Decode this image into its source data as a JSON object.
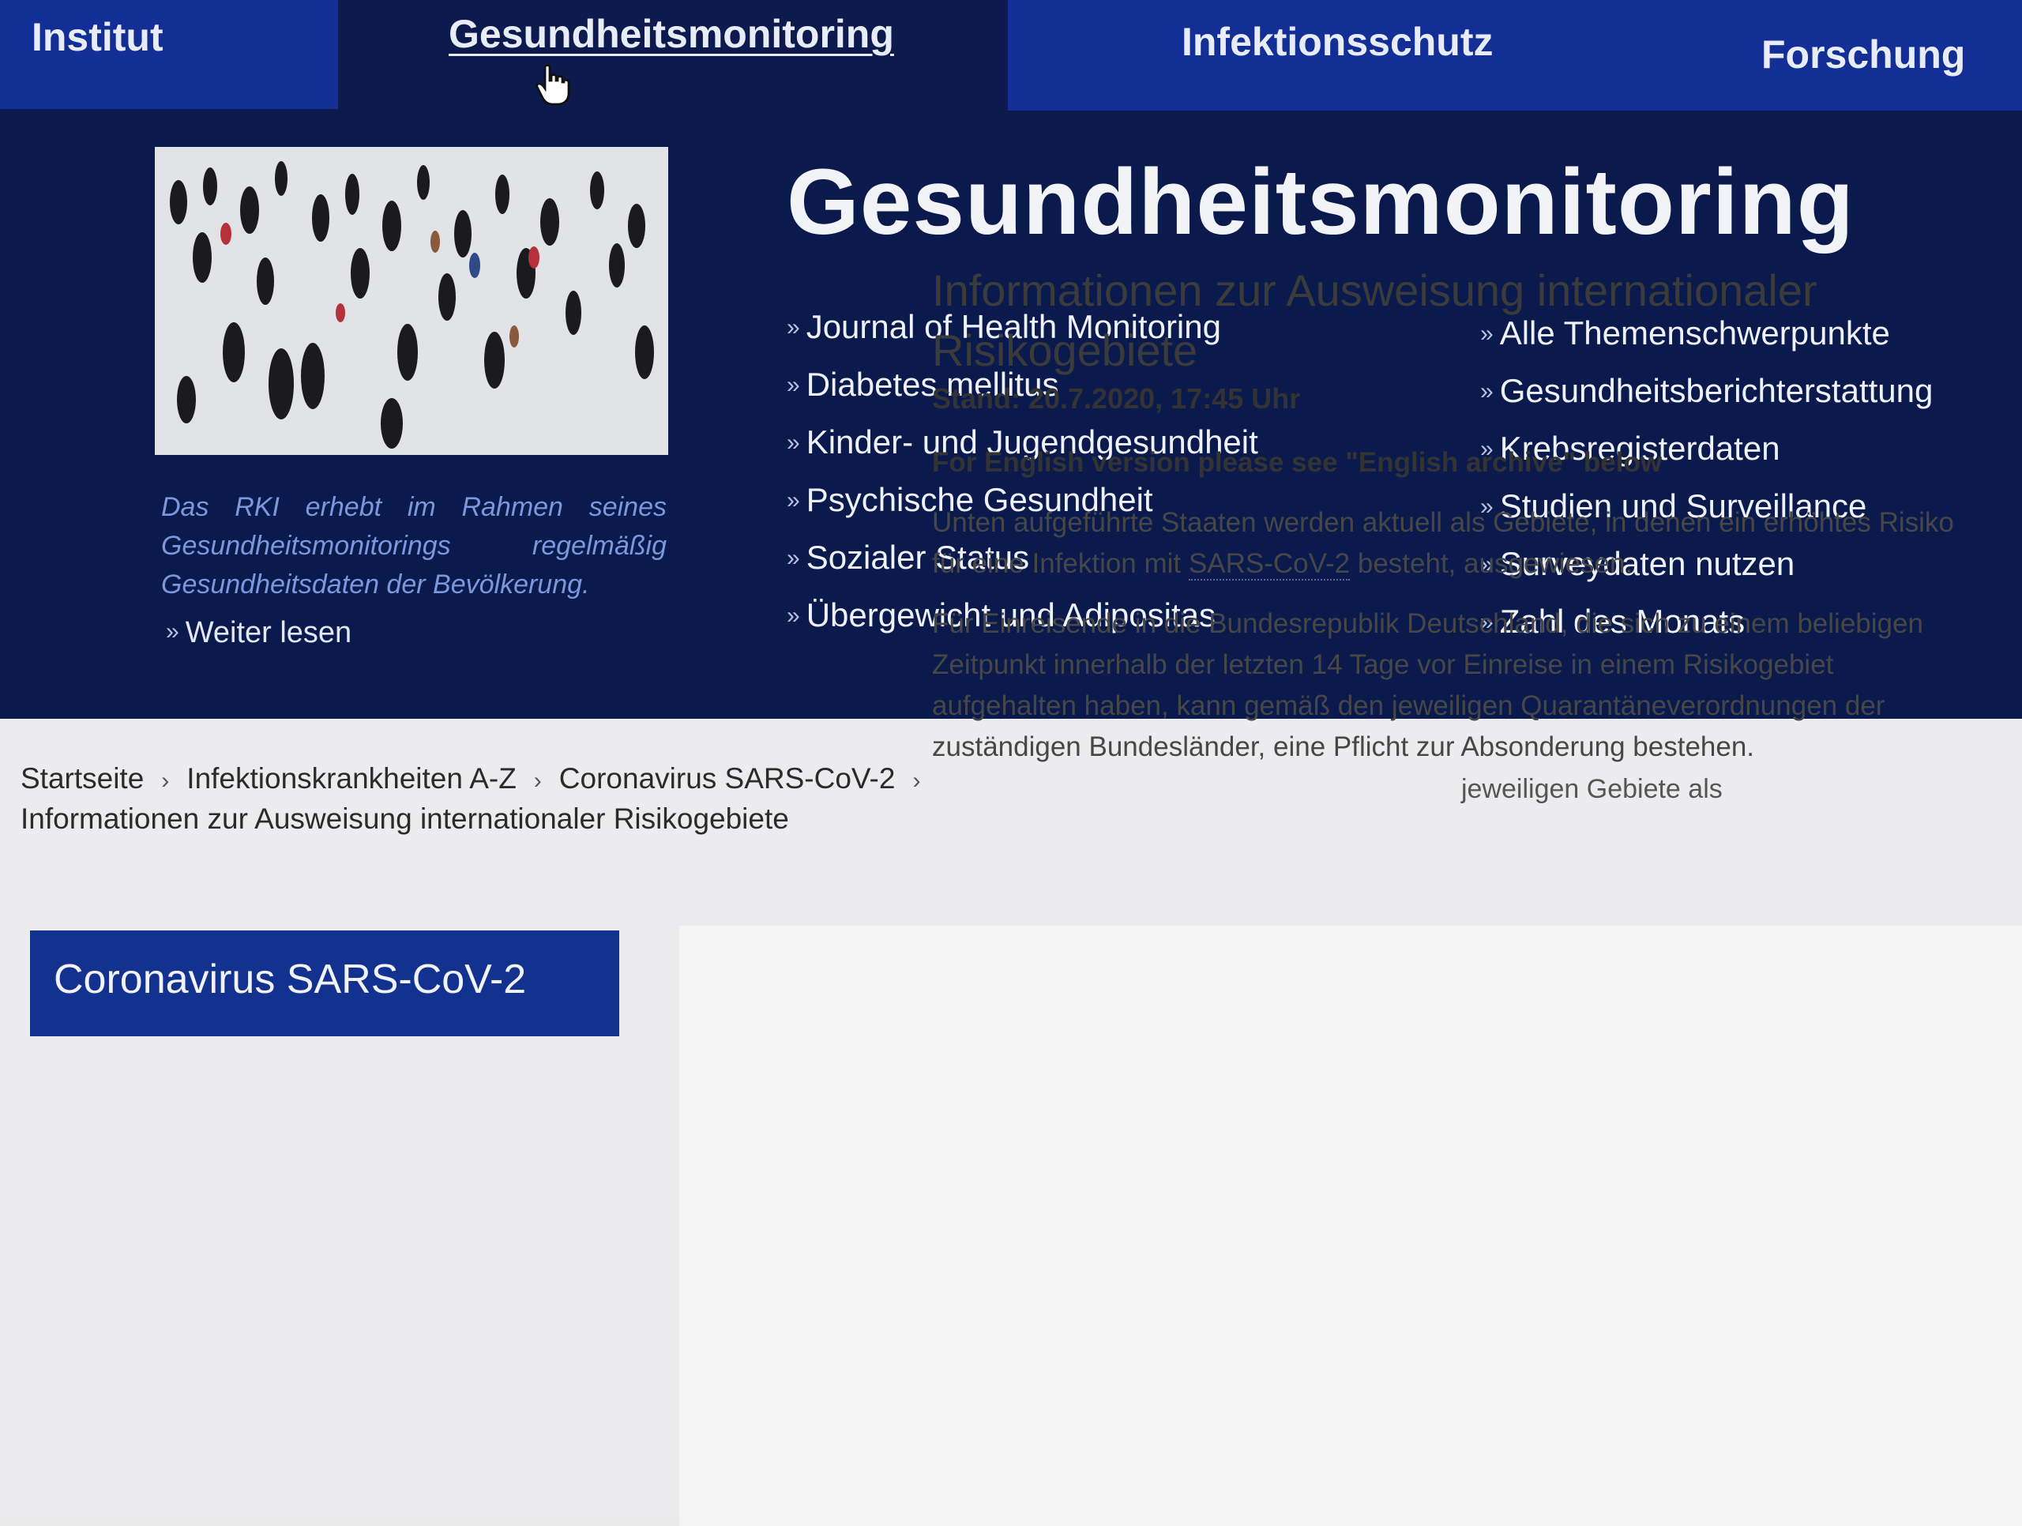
{
  "topnav": {
    "items": [
      {
        "label": "Institut"
      },
      {
        "label": "Gesundheitsmonitoring"
      },
      {
        "label": "Infektionsschutz"
      },
      {
        "label": "Forschung"
      }
    ]
  },
  "mega": {
    "title": "Gesundheitsmonitoring",
    "intro": "Das RKI erhebt im Rahmen seines Gesundheitsmonitorings regelmäßig Gesundheitsdaten der Bevölkerung.",
    "read_more": "Weiter lesen",
    "col1": [
      "Journal of Health Monitoring",
      "Diabetes mellitus",
      "Kinder- und Jugendgesundheit",
      "Psychische Gesundheit",
      "Sozialer Status",
      "Übergewicht und Adipositas"
    ],
    "col2": [
      "Alle Themenschwerpunkte",
      "Gesundheitsberichterstattung",
      "Krebsregisterdaten",
      "Studien und Surveillance",
      "Surveydaten nutzen",
      "Zahl des Monats"
    ]
  },
  "breadcrumb": {
    "items": [
      "Startseite",
      "Infektionskrankheiten A-Z",
      "Coronavirus SARS-CoV-2",
      "Informationen zur Ausweisung internationaler Risikogebiete"
    ],
    "separator": "›"
  },
  "sidebar": {
    "heading": "Coronavirus SARS-CoV-2"
  },
  "main": {
    "title": "Informationen zur Ausweisung internationaler Risikogebiete",
    "stand": "Stand: 20.7.2020, 17:45 Uhr",
    "english_note": "For English version please see \"English archive\" below",
    "para1_before": "Unten aufgeführte Staaten werden aktuell als Gebiete, in denen ein erhöhtes Risiko für eine Infektion mit ",
    "para1_link": "SARS-CoV-2",
    "para1_after": " besteht, ausgewiesen.",
    "para2": "Für Einreisende in die Bundesrepublik Deutschland, die sich zu einem beliebigen Zeitpunkt innerhalb der letzten 14 Tage vor Einreise in einem Risikogebiet aufgehalten haben, kann gemäß den jeweiligen Quarantäneverordnungen der zuständigen Bundesländer, eine Pflicht zur Absonderung bestehen.",
    "para3_partial": "jeweiligen Gebiete als"
  },
  "colors": {
    "nav_blue": "#132f96",
    "dark_navy": "#0b1a4d",
    "intro_text": "#7b98dd",
    "side_box": "#13318f"
  },
  "icons": {
    "cursor": "hand-pointer-icon",
    "bullet": "double-chevron-right-icon",
    "breadcrumb_separator": "chevron-right-icon"
  }
}
